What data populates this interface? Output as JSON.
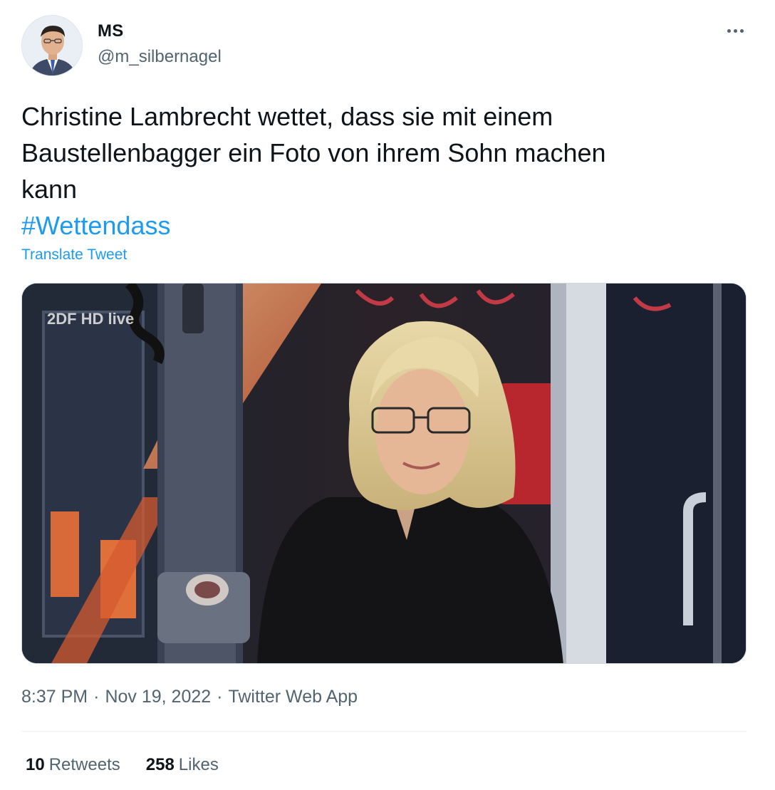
{
  "author": {
    "display_name": "MS",
    "handle": "@m_silbernagel",
    "avatar_icon": "profile-photo"
  },
  "tweet": {
    "text_lines": [
      "Christine Lambrecht wettet, dass sie mit einem",
      "Baustellenbagger ein Foto von ihrem Sohn machen",
      "kann"
    ],
    "hashtag": "#Wettendass",
    "translate_label": "Translate Tweet"
  },
  "media": {
    "overlay_logo": "2DF HD live"
  },
  "meta": {
    "time": "8:37 PM",
    "date": "Nov 19, 2022",
    "source": "Twitter Web App",
    "separator": "·"
  },
  "stats": {
    "retweets_count": "10",
    "retweets_label": "Retweets",
    "likes_count": "258",
    "likes_label": "Likes"
  },
  "colors": {
    "link": "#1d9bf0",
    "secondary_text": "#536471",
    "primary_text": "#0f1419"
  }
}
